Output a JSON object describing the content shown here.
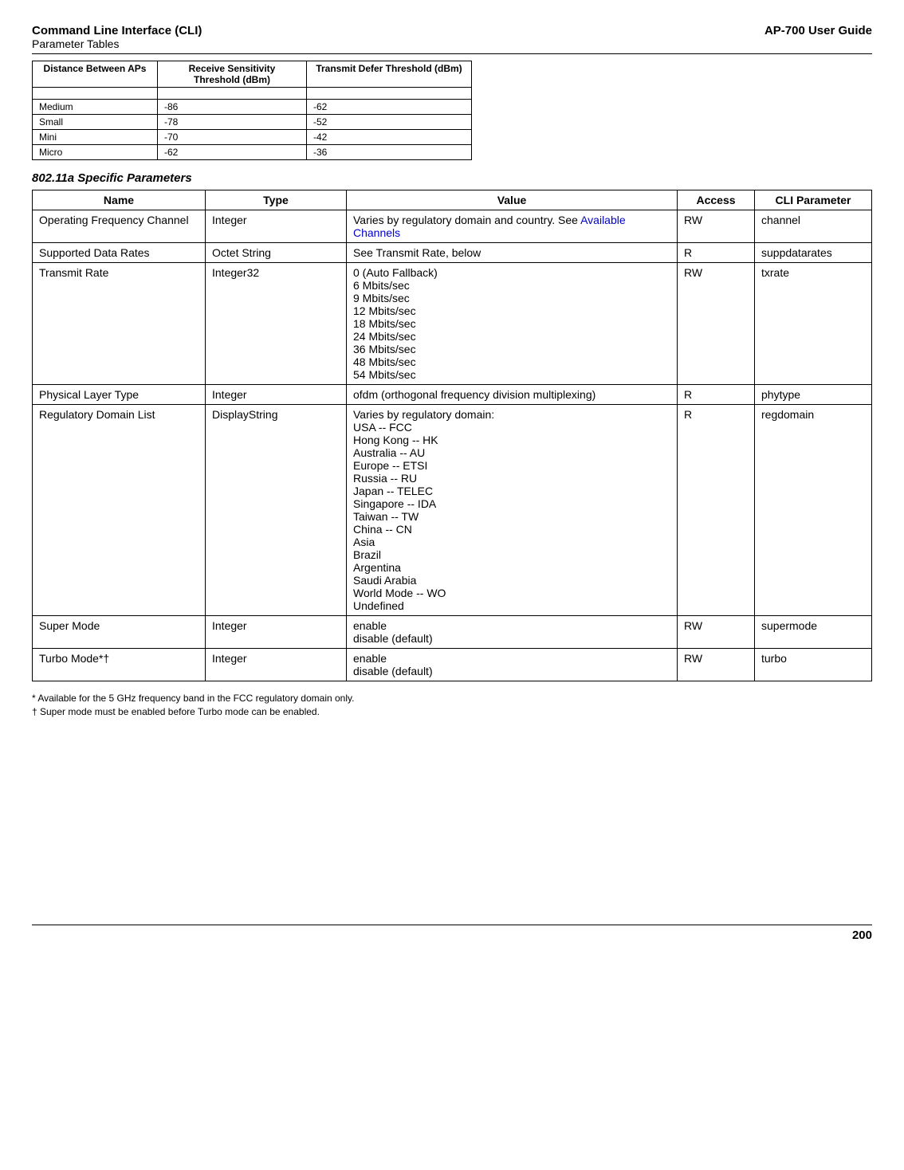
{
  "header": {
    "leftTop": "Command Line Interface (CLI)",
    "leftBottom": "Parameter Tables",
    "right": "AP-700 User Guide"
  },
  "smallTable": {
    "headers": {
      "c1": "Distance Between APs",
      "c2": "Receive Sensitivity Threshold (dBm)",
      "c3": "Transmit Defer Threshold (dBm)"
    },
    "rows": [
      {
        "c1": "Medium",
        "c2": "-86",
        "c3": "-62"
      },
      {
        "c1": "Small",
        "c2": "-78",
        "c3": "-52"
      },
      {
        "c1": "Mini",
        "c2": "-70",
        "c3": "-42"
      },
      {
        "c1": "Micro",
        "c2": "-62",
        "c3": "-36"
      }
    ]
  },
  "sectionHeading": "802.11a Specific Parameters",
  "bigTable": {
    "headers": {
      "name": "Name",
      "type": "Type",
      "value": "Value",
      "access": "Access",
      "cli": "CLI Parameter"
    },
    "rows": [
      {
        "name": "Operating Frequency Channel",
        "type": "Integer",
        "valuePrefix": "Varies by regulatory domain and country. See ",
        "valueLink": "Available Channels",
        "access": "RW",
        "cli": "channel"
      },
      {
        "name": "Supported Data Rates",
        "type": "Octet String",
        "value": "See Transmit Rate, below",
        "access": "R",
        "cli": "suppdatarates"
      },
      {
        "name": "Transmit Rate",
        "type": "Integer32",
        "valueLines": [
          "0 (Auto Fallback)",
          "6 Mbits/sec",
          "9 Mbits/sec",
          "12 Mbits/sec",
          "18 Mbits/sec",
          "24 Mbits/sec",
          "36 Mbits/sec",
          "48 Mbits/sec",
          "54 Mbits/sec"
        ],
        "access": "RW",
        "cli": "txrate"
      },
      {
        "name": "Physical Layer Type",
        "type": "Integer",
        "value": "ofdm (orthogonal frequency division multiplexing)",
        "access": "R",
        "cli": "phytype"
      },
      {
        "name": "Regulatory Domain List",
        "type": "DisplayString",
        "valueLines": [
          "Varies by regulatory domain:",
          "USA -- FCC",
          "Hong Kong -- HK",
          "Australia -- AU",
          "Europe -- ETSI",
          "Russia -- RU",
          "Japan -- TELEC",
          "Singapore -- IDA",
          "Taiwan -- TW",
          "China -- CN",
          "Asia",
          "Brazil",
          "Argentina",
          "Saudi Arabia",
          "World Mode -- WO",
          "Undefined"
        ],
        "access": "R",
        "cli": "regdomain"
      },
      {
        "name": "Super Mode",
        "type": "Integer",
        "valueLines": [
          "enable",
          "disable (default)"
        ],
        "access": "RW",
        "cli": "supermode"
      },
      {
        "name": "Turbo Mode*†",
        "type": "Integer",
        "valueLines": [
          "enable",
          "disable (default)"
        ],
        "access": "RW",
        "cli": "turbo"
      }
    ]
  },
  "footnotes": {
    "f1": "*  Available for the 5 GHz frequency band in the FCC regulatory domain only.",
    "f2": "†  Super mode must be enabled before Turbo mode can be enabled."
  },
  "pageNumber": "200"
}
